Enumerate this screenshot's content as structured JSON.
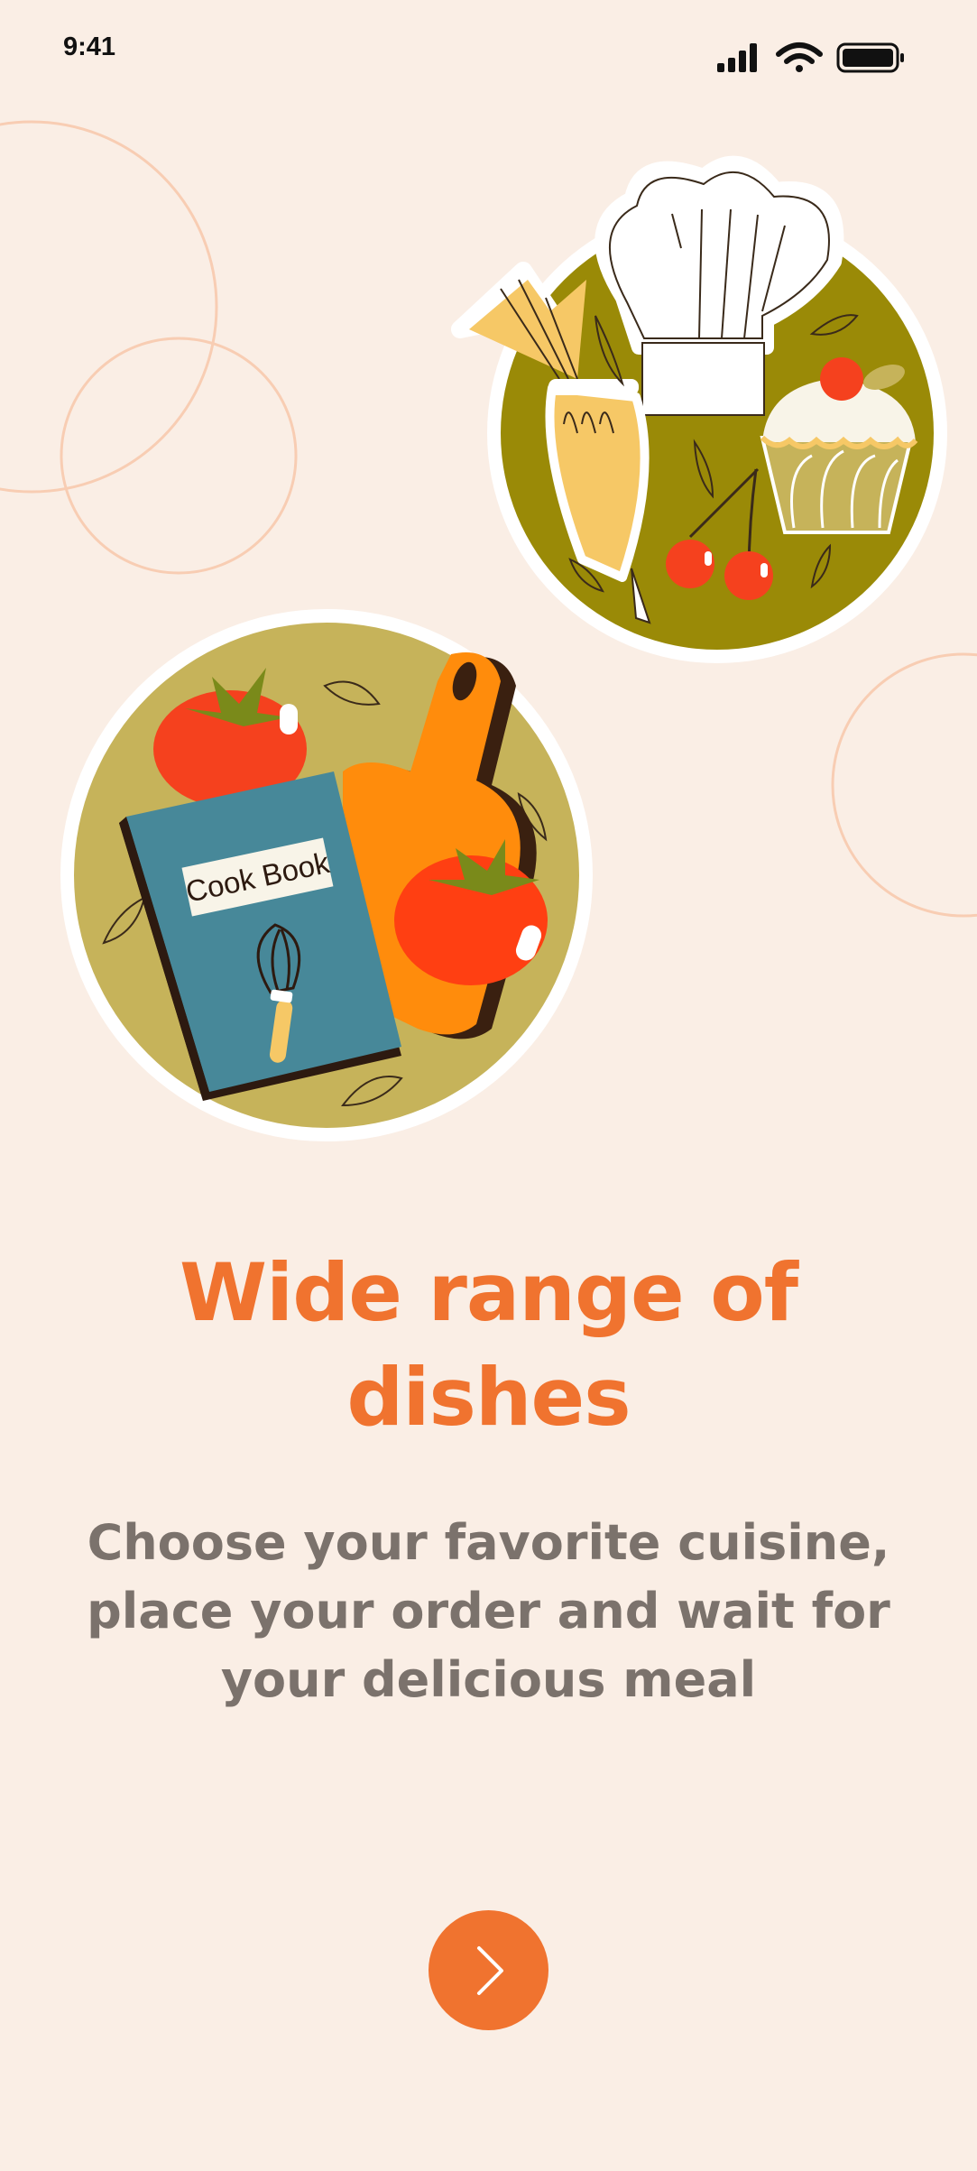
{
  "status_bar": {
    "time": "9:41",
    "icons": [
      "cellular-signal-icon",
      "wifi-icon",
      "battery-icon"
    ]
  },
  "illustration": {
    "book_label": "Cook Book"
  },
  "onboarding": {
    "headline": "Wide range of dishes",
    "subtitle": "Choose your favorite cuisine, place your order and wait for your delicious meal",
    "next_button_icon": "chevron-right-icon"
  },
  "colors": {
    "background": "#FAEEE5",
    "accent": "#F0732F",
    "headline": "#F0732F",
    "subtitle": "#7B726C",
    "decor_circles": "#F8CDB3",
    "olive_plate": "#9A8A07",
    "khaki_plate": "#C6B35A",
    "book_blue": "#478899",
    "tomato_red": "#FF3F12",
    "board_orange": "#FF8C0C"
  }
}
